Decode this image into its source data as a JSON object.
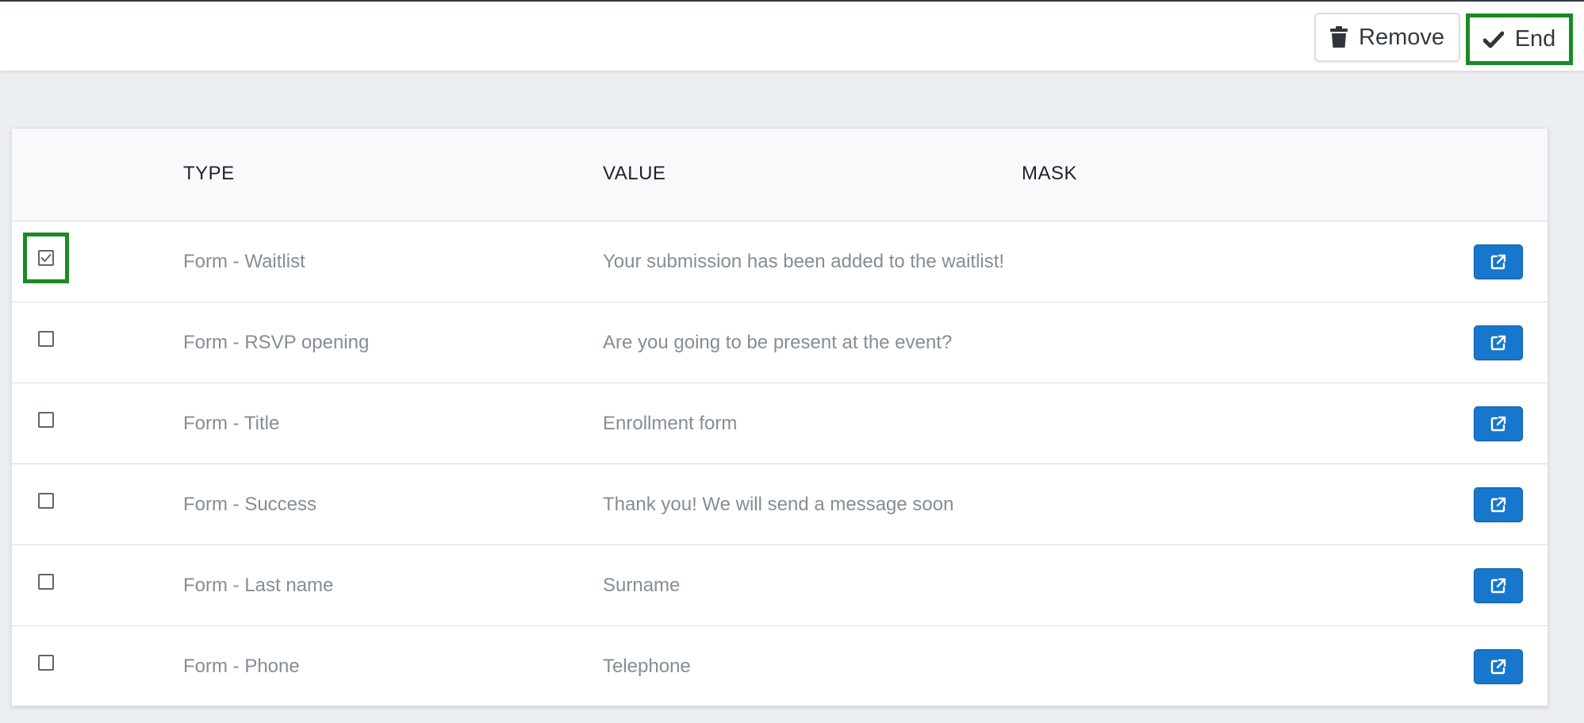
{
  "toolbar": {
    "remove_label": "Remove",
    "remove_icon": "trash-icon",
    "end_label": "End",
    "end_icon": "checkmark-icon"
  },
  "table": {
    "headers": {
      "type": "TYPE",
      "value": "VALUE",
      "mask": "MASK"
    },
    "rows": [
      {
        "checked": true,
        "type": "Form - Waitlist",
        "value": "Your submission has been added to the waitlist!",
        "mask": ""
      },
      {
        "checked": false,
        "type": "Form - RSVP opening",
        "value": "Are you going to be present at the event?",
        "mask": ""
      },
      {
        "checked": false,
        "type": "Form - Title",
        "value": "Enrollment form",
        "mask": ""
      },
      {
        "checked": false,
        "type": "Form - Success",
        "value": "Thank you! We will send a message soon",
        "mask": ""
      },
      {
        "checked": false,
        "type": "Form - Last name",
        "value": "Surname",
        "mask": ""
      },
      {
        "checked": false,
        "type": "Form - Phone",
        "value": "Telephone",
        "mask": ""
      }
    ],
    "row_action_icon": "external-link-icon"
  },
  "colors": {
    "highlight": "#1b8a23",
    "primary_button": "#1677cc",
    "page_background": "#eceff1",
    "muted_text": "#858d95"
  }
}
